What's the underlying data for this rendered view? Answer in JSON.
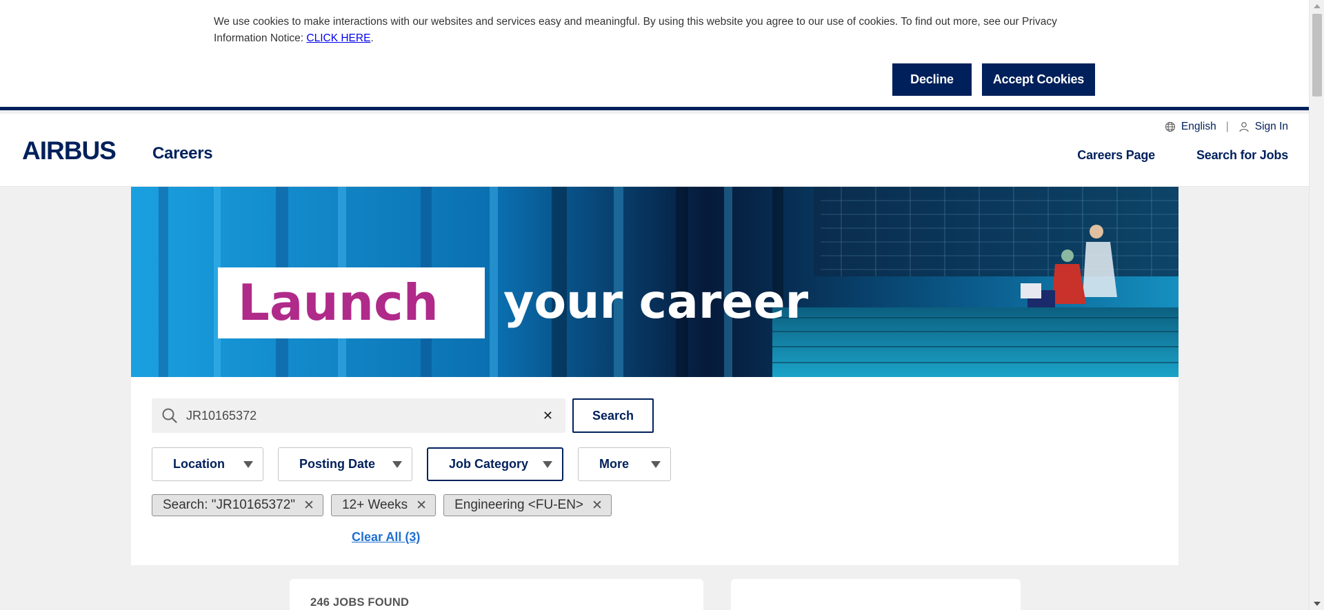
{
  "cookie_banner": {
    "text": "We use cookies to make interactions with our websites and services easy and meaningful. By using this website you agree to our use of cookies. To find out more, see our Privacy Information Notice: ",
    "link_label": "CLICK HERE",
    "after_link": ".",
    "decline_label": "Decline",
    "accept_label": "Accept Cookies"
  },
  "header": {
    "logo_text": "AIRBUS",
    "site_title": "Careers",
    "language": "English",
    "sign_in": "Sign In",
    "nav": [
      "Careers Page",
      "Search for Jobs"
    ]
  },
  "hero": {
    "word1": "Launch",
    "word2": "your career"
  },
  "search": {
    "value": "JR10165372",
    "button_label": "Search"
  },
  "filters": [
    {
      "label": "Location"
    },
    {
      "label": "Posting Date"
    },
    {
      "label": "Job Category"
    },
    {
      "label": "More"
    }
  ],
  "chips": [
    {
      "label": "Search: \"JR10165372\""
    },
    {
      "label": "12+ Weeks"
    },
    {
      "label": "Engineering <FU-EN>"
    }
  ],
  "clear_all": "Clear All (3)",
  "results": {
    "count_label": "246 JOBS FOUND"
  },
  "colors": {
    "brand_navy": "#00205b",
    "link_blue": "#1e6fd0",
    "hero_magenta": "#b02a8a"
  }
}
